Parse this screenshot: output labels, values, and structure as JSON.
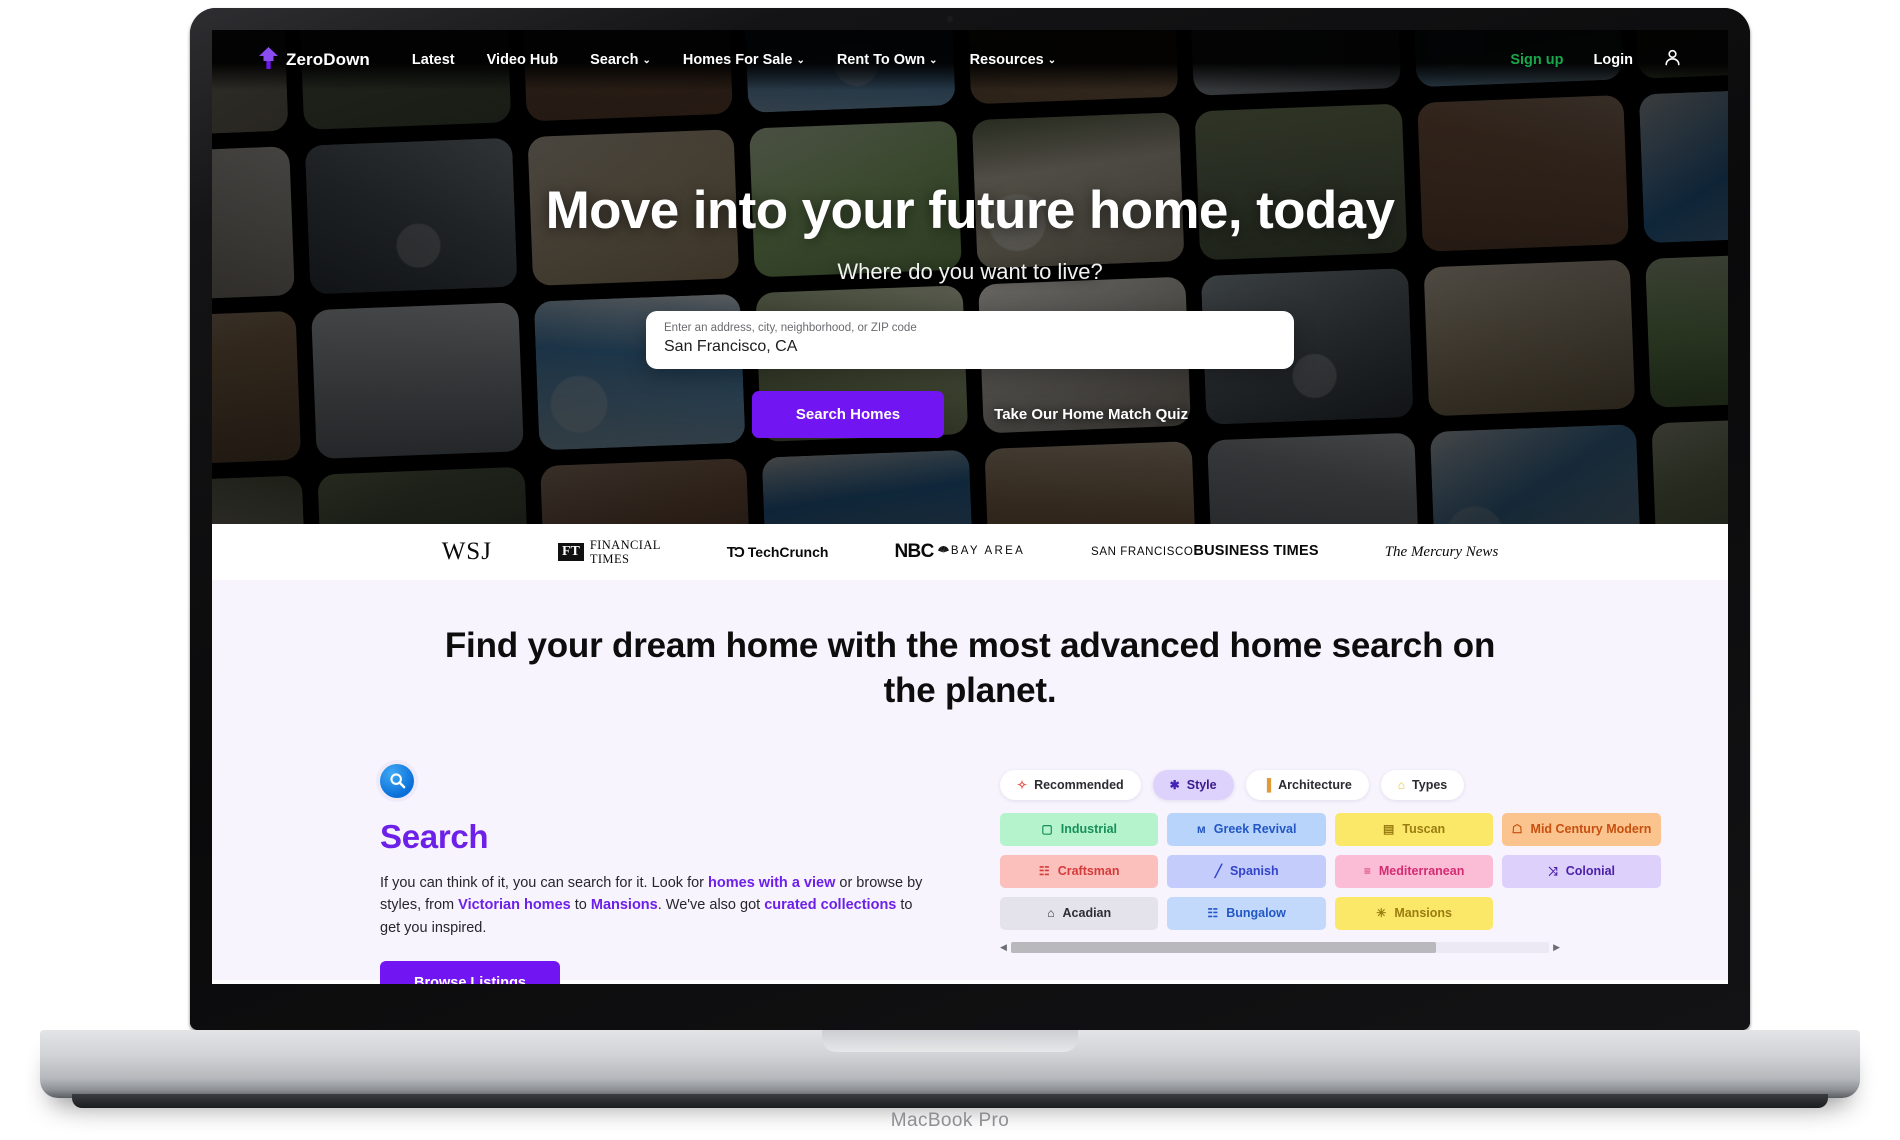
{
  "device": {
    "label": "MacBook Pro"
  },
  "nav": {
    "brand": "ZeroDown",
    "links": [
      {
        "label": "Latest",
        "caret": false
      },
      {
        "label": "Video Hub",
        "caret": false
      },
      {
        "label": "Search",
        "caret": true
      },
      {
        "label": "Homes For Sale",
        "caret": true
      },
      {
        "label": "Rent To Own",
        "caret": true
      },
      {
        "label": "Resources",
        "caret": true
      }
    ],
    "caret_glyph": "⌄",
    "signup": "Sign up",
    "login": "Login",
    "account_icon": "user-icon",
    "signup_color": "#18a84b"
  },
  "hero": {
    "title": "Move into your future home, today",
    "subtitle": "Where do you want to live?",
    "search": {
      "placeholder": "Enter an address, city, neighborhood, or ZIP code",
      "value": "San Francisco, CA"
    },
    "primary_button": "Search Homes",
    "secondary_button": "Take Our Home Match Quiz",
    "accent_color": "#7215f3"
  },
  "press": {
    "wsj": "WSJ",
    "ft_mark": "FT",
    "ft_line1": "FINANCIAL",
    "ft_line2": "TIMES",
    "tc_mark": "TƆ",
    "tc_name": "TechCrunch",
    "nbc_top": "NBC",
    "nbc_bottom": "BAY AREA",
    "sfbt_line1": "SAN FRANCISCO",
    "sfbt_line2": "BUSINESS TIMES",
    "mercury": "The Mercury News"
  },
  "main": {
    "headline": "Find your dream home with the most advanced home search on the planet.",
    "feature": {
      "badge_icon": "search-icon",
      "title": "Search",
      "copy_part1": "If you can think of it, you can search for it. Look for ",
      "link1": "homes with a view",
      "copy_part2": " or browse by styles, from ",
      "link2": "Victorian homes",
      "copy_part3": " to ",
      "link3": "Mansions",
      "copy_part4": ". We've also got ",
      "link4": "curated collections",
      "copy_part5": " to get you inspired.",
      "button": "Browse Listings",
      "link_color": "#6d20e8"
    },
    "chip_tabs": [
      {
        "label": "Recommended",
        "icon": "sparkle-icon",
        "glyph": "✧",
        "selected": false,
        "icon_color": "#e8584f"
      },
      {
        "label": "Style",
        "icon": "asterisk-icon",
        "glyph": "✱",
        "selected": true,
        "icon_color": "#4423b5"
      },
      {
        "label": "Architecture",
        "icon": "column-icon",
        "glyph": "▐",
        "selected": false,
        "icon_color": "#e09a3c"
      },
      {
        "label": "Types",
        "icon": "house-types-icon",
        "glyph": "⌂",
        "selected": false,
        "icon_color": "#e3c23a"
      }
    ],
    "chips": [
      {
        "label": "Industrial",
        "glyph": "▢",
        "bg": "#b5f3cd",
        "fg": "#17905a"
      },
      {
        "label": "Greek Revival",
        "glyph": "ᴍ",
        "bg": "#b9d4fb",
        "fg": "#2257c4"
      },
      {
        "label": "Tuscan",
        "glyph": "▤",
        "bg": "#fbe868",
        "fg": "#9a7c12"
      },
      {
        "label": "Mid Century Modern",
        "glyph": "☖",
        "bg": "#fbc38e",
        "fg": "#c7500f"
      },
      {
        "label": "Craftsman",
        "glyph": "☷",
        "bg": "#fbc0bc",
        "fg": "#d43b3b"
      },
      {
        "label": "Spanish",
        "glyph": "╱",
        "bg": "#c3ccfb",
        "fg": "#3344c9"
      },
      {
        "label": "Mediterranean",
        "glyph": "≡",
        "bg": "#fbbdd6",
        "fg": "#d42b72"
      },
      {
        "label": "Colonial",
        "glyph": "⤨",
        "bg": "#ddd0fb",
        "fg": "#4b1fa8"
      },
      {
        "label": "Acadian",
        "glyph": "⌂",
        "bg": "#e4e2ea",
        "fg": "#2d2d33"
      },
      {
        "label": "Bungalow",
        "glyph": "☷",
        "bg": "#c3d9fb",
        "fg": "#2257c4"
      },
      {
        "label": "Mansions",
        "glyph": "✳",
        "bg": "#fbe868",
        "fg": "#9a7c12"
      }
    ],
    "scroll": {
      "left_arrow": "◀",
      "right_arrow": "▶",
      "position_percent": 79
    }
  }
}
